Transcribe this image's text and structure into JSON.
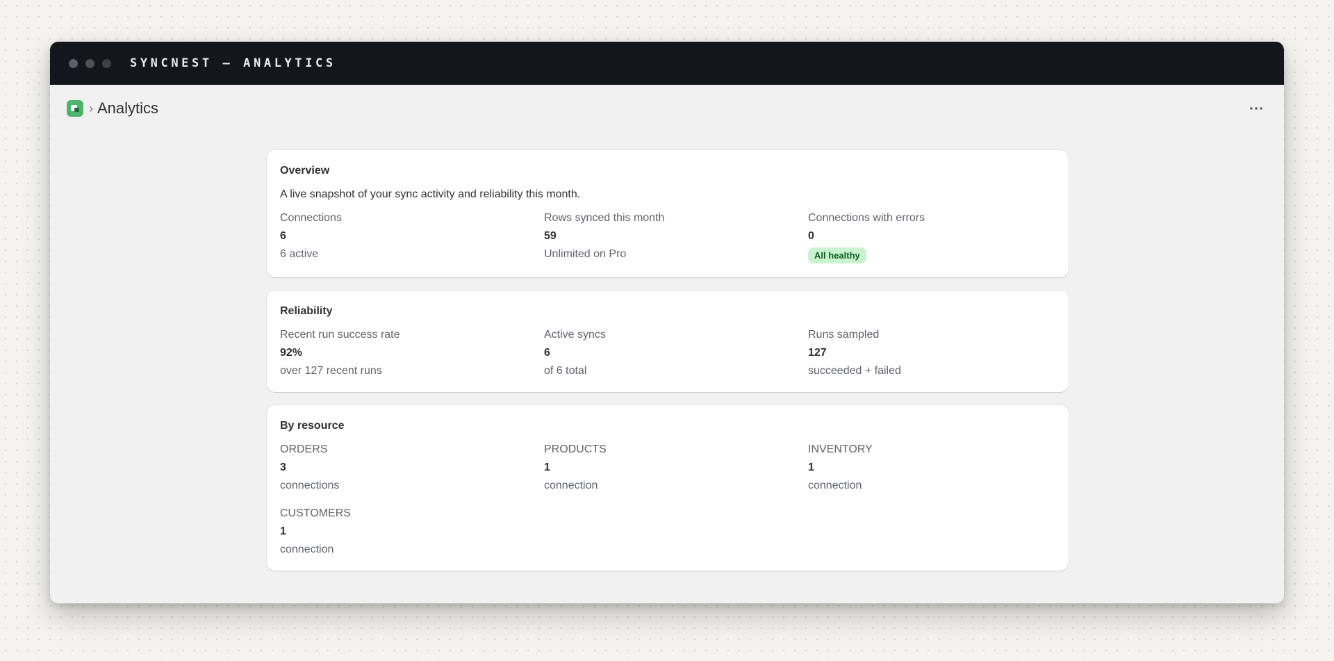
{
  "window": {
    "title": "SYNCNEST — ANALYTICS"
  },
  "header": {
    "breadcrumb_separator": "›",
    "page_title": "Analytics",
    "more_icon": "more-horizontal-icon",
    "app_icon": "app-logo-icon"
  },
  "overview": {
    "title": "Overview",
    "description": "A live snapshot of your sync activity and reliability this month.",
    "stats": [
      {
        "label": "Connections",
        "value": "6",
        "sub": "6 active"
      },
      {
        "label": "Rows synced this month",
        "value": "59",
        "sub": "Unlimited on Pro"
      },
      {
        "label": "Connections with errors",
        "value": "0",
        "badge": "All healthy"
      }
    ]
  },
  "reliability": {
    "title": "Reliability",
    "stats": [
      {
        "label": "Recent run success rate",
        "value": "92%",
        "sub": "over 127 recent runs"
      },
      {
        "label": "Active syncs",
        "value": "6",
        "sub": "of 6 total"
      },
      {
        "label": "Runs sampled",
        "value": "127",
        "sub": "succeeded + failed"
      }
    ]
  },
  "by_resource": {
    "title": "By resource",
    "stats": [
      {
        "label": "ORDERS",
        "value": "3",
        "sub": "connections"
      },
      {
        "label": "PRODUCTS",
        "value": "1",
        "sub": "connection"
      },
      {
        "label": "INVENTORY",
        "value": "1",
        "sub": "connection"
      },
      {
        "label": "CUSTOMERS",
        "value": "1",
        "sub": "connection"
      }
    ]
  },
  "colors": {
    "titlebar": "#13161c",
    "accent_green": "#4fb36b",
    "badge_bg": "#c9f2cf",
    "badge_text": "#0d5c22"
  }
}
